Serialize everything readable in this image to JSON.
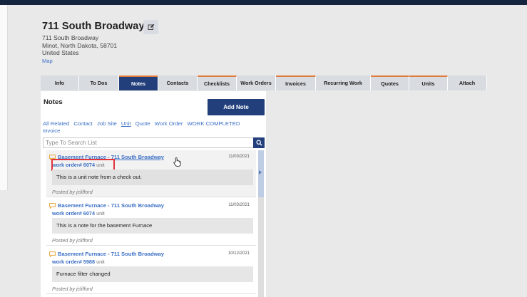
{
  "site": {
    "title": "711 South Broadway",
    "address_line1": "711 South Broadway",
    "address_line2": "Minot, North Dakota, 58701",
    "country": "United States",
    "map_link": "Map"
  },
  "tabs": [
    {
      "label": "Info"
    },
    {
      "label": "To Dos"
    },
    {
      "label": "Notes",
      "active": true
    },
    {
      "label": "Contacts"
    },
    {
      "label": "Checklists"
    },
    {
      "label": "Work Orders"
    },
    {
      "label": "Invoices"
    },
    {
      "label": "Recurring Work"
    },
    {
      "label": "Quotes"
    },
    {
      "label": "Units"
    },
    {
      "label": "Attach"
    }
  ],
  "notes_panel": {
    "title": "Notes",
    "add_button": "Add Note",
    "filters": [
      "All Related",
      "Contact",
      "Job Site",
      "Unit",
      "Quote",
      "Work Order",
      "WORK COMPLETED",
      "Invoice"
    ],
    "search_placeholder": "Type To Search List"
  },
  "notes": [
    {
      "title": "Basement Furnace - 711 South Broadway",
      "date": "11/03/2021",
      "work_order": "work order# 6074",
      "type": "unit",
      "body": "This is a unit note from a check out.",
      "posted_by": "Posted by jclifford"
    },
    {
      "title": "Basement Furnace - 711 South Broadway",
      "date": "11/03/2021",
      "work_order": "work order# 6074",
      "type": "unit",
      "body": "This is a note for the basement Furnace",
      "posted_by": "Posted by jclifford"
    },
    {
      "title": "Basement Furnace - 711 South Broadway",
      "date": "10/12/2021",
      "work_order": "work order# 5988",
      "type": "unit",
      "body": "Furnace filter changed",
      "posted_by": "Posted by jclifford"
    }
  ],
  "colors": {
    "primary": "#223f7c",
    "link": "#3b6fc5",
    "accent_orange": "#e07a3a",
    "highlight_red": "#e0323b"
  }
}
